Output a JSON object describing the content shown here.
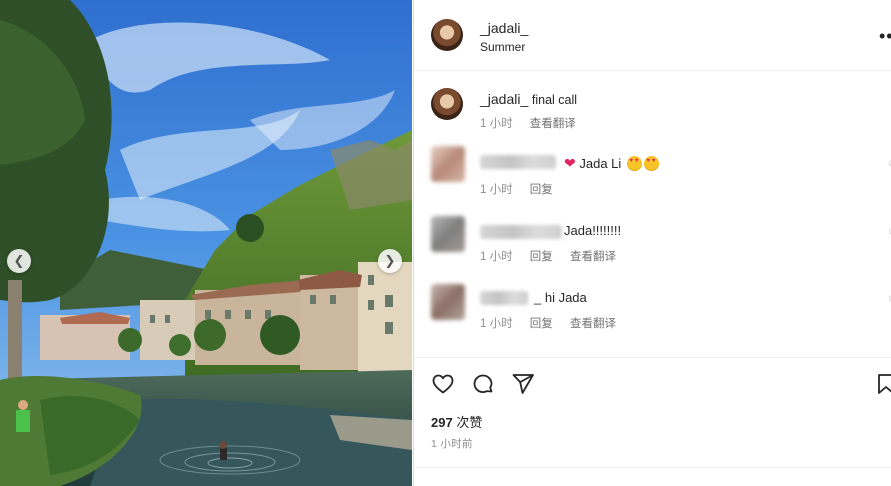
{
  "post": {
    "username": "_jadali_",
    "location": "Summer",
    "more_icon": "more-horizontal-icon"
  },
  "caption": {
    "username": "_jadali_",
    "text": "final call",
    "time": "1 小时",
    "translate": "查看翻译"
  },
  "comments": [
    {
      "text_before": "Jada Li",
      "emoji": "heart-eyes",
      "time": "1 小时",
      "reply": "回复"
    },
    {
      "text_before": "Jada!!!!!!!!",
      "time": "1 小时",
      "reply": "回复",
      "translate": "查看翻译"
    },
    {
      "text_before": "_ hi Jada",
      "time": "1 小时",
      "reply": "回复",
      "translate": "查看翻译"
    }
  ],
  "likes": {
    "count": "297",
    "label": "次赞"
  },
  "timestamp": "1 小时前",
  "icons": {
    "like": "heart-icon",
    "comment": "comment-icon",
    "share": "send-icon",
    "save": "bookmark-icon",
    "prev": "chevron-left-icon",
    "next": "chevron-right-icon"
  },
  "colors": {
    "text": "#262626",
    "meta": "#8e8e8e",
    "heart": "#e0245e",
    "border": "#dbdbdb"
  }
}
